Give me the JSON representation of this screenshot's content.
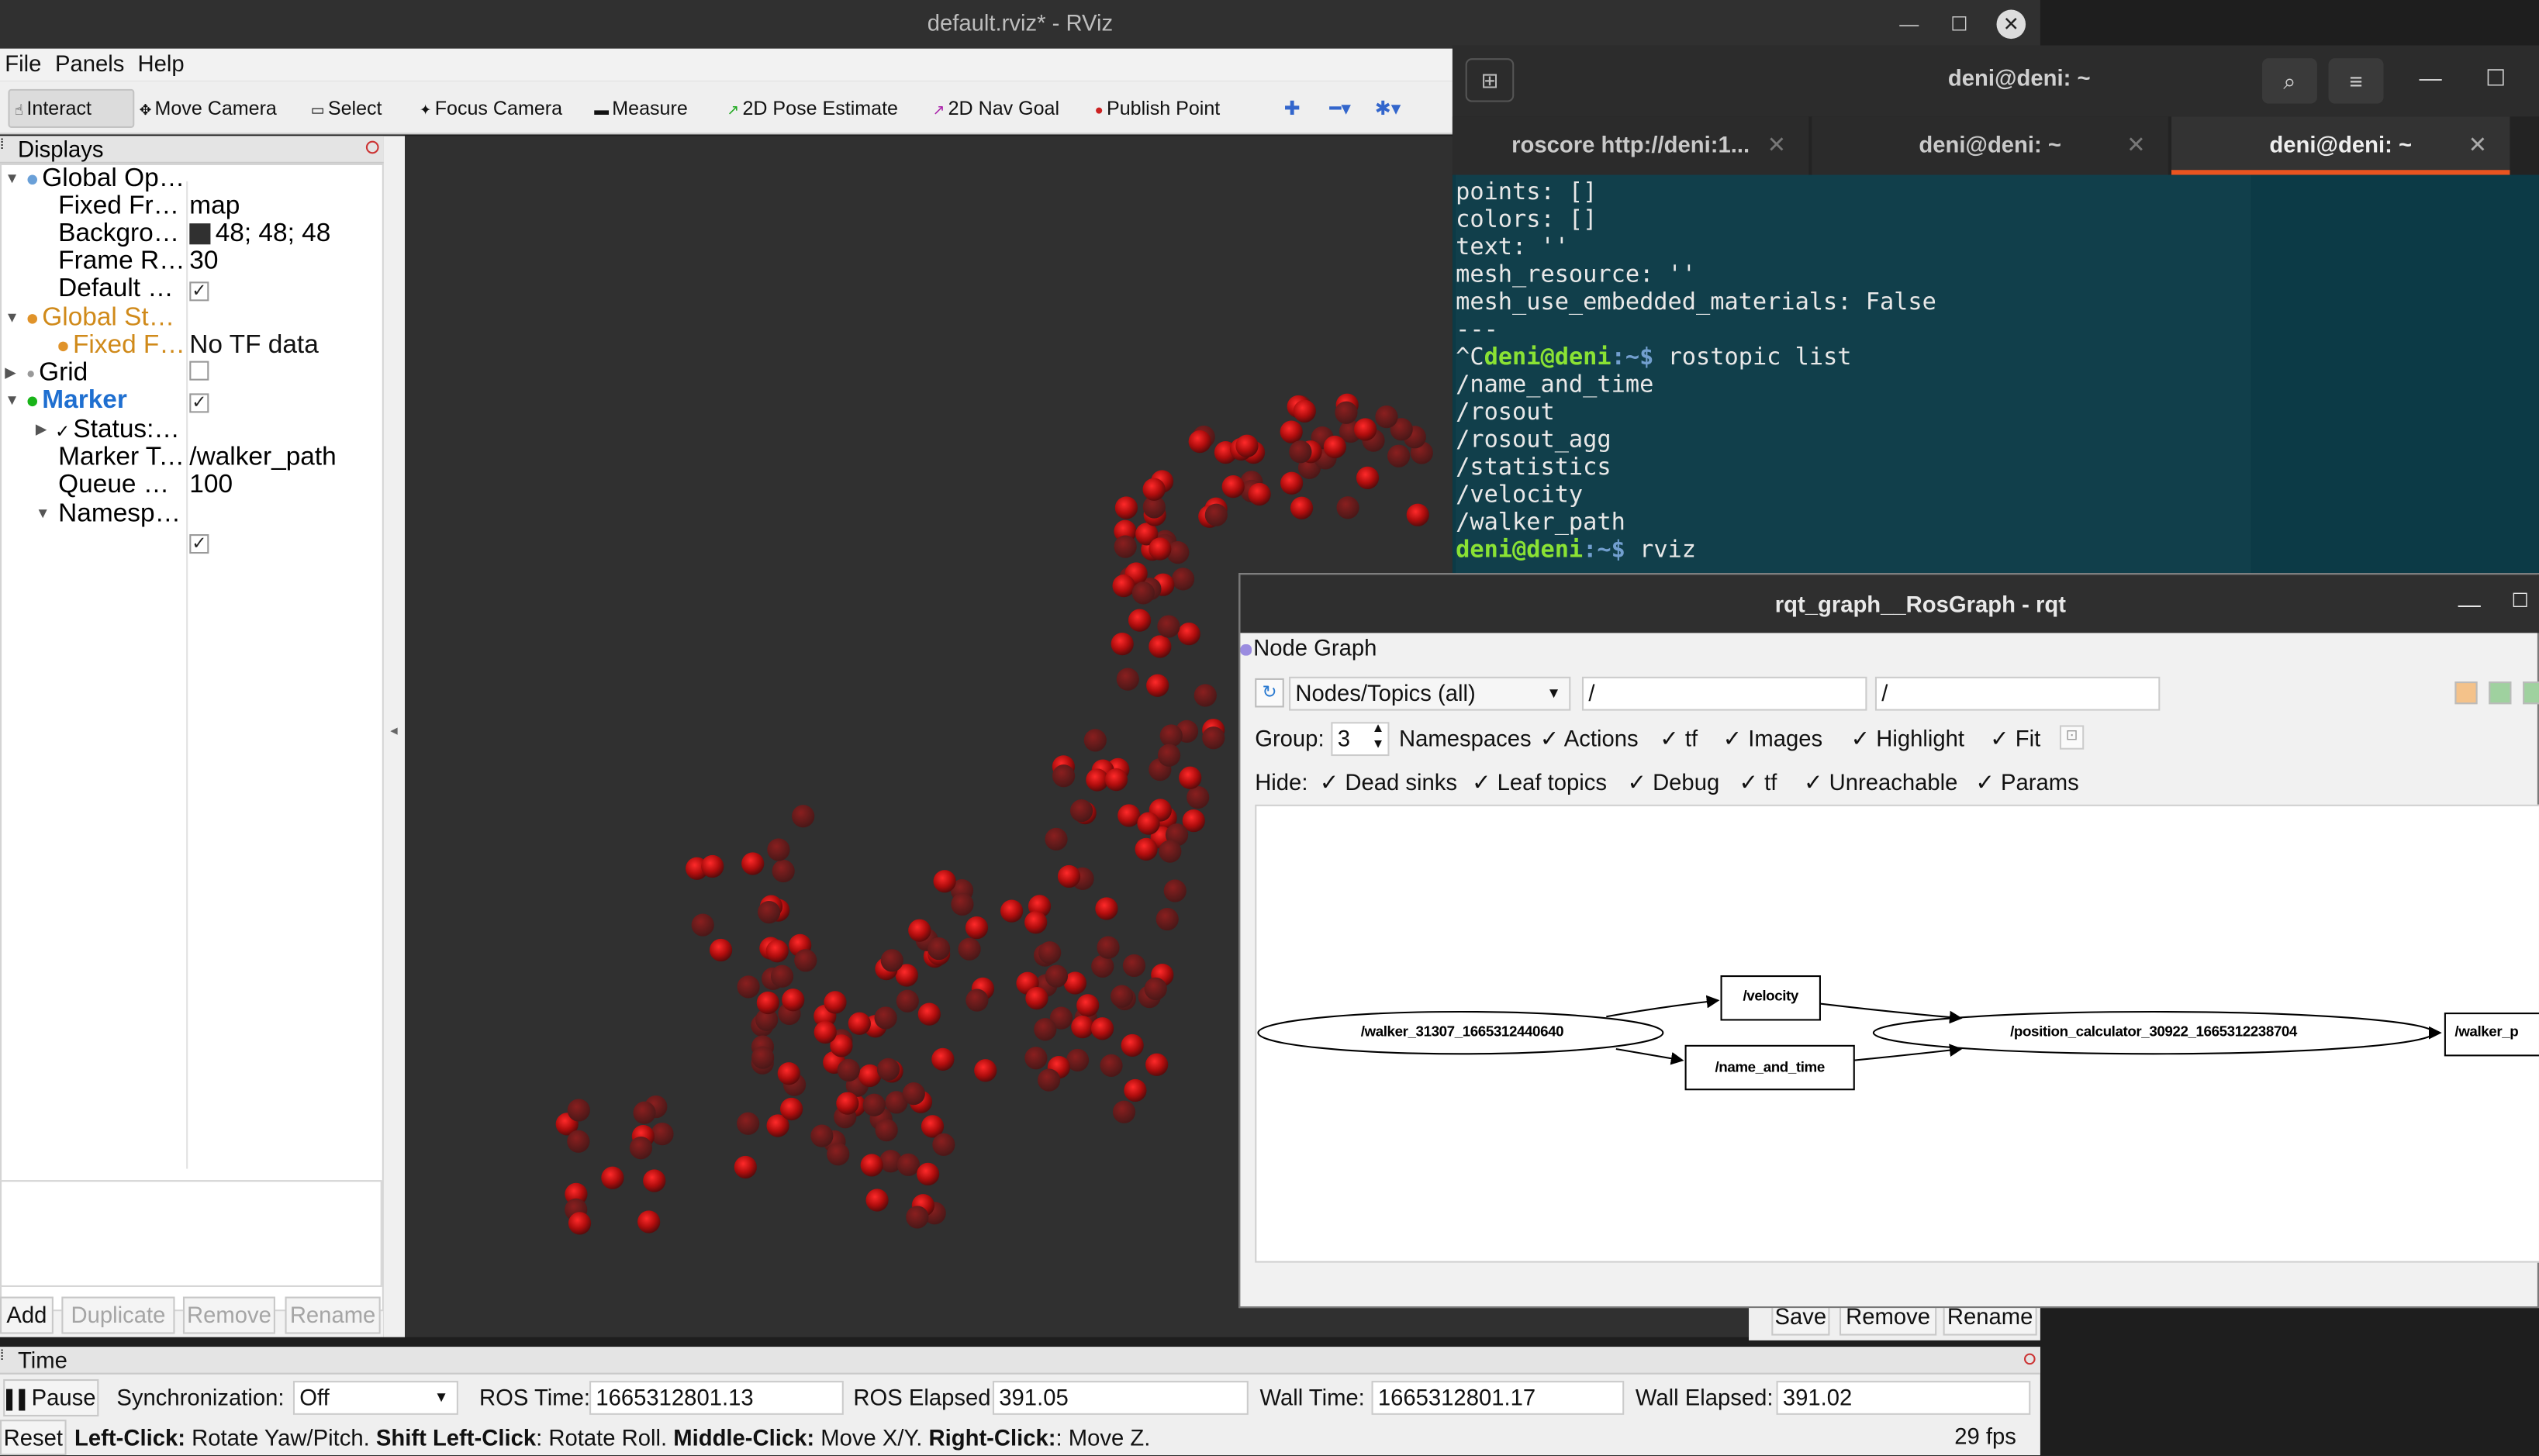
{
  "rviz": {
    "title": "default.rviz* - RViz",
    "menu": [
      "File",
      "Panels",
      "Help"
    ],
    "toolbar": [
      "Interact",
      "Move Camera",
      "Select",
      "Focus Camera",
      "Measure",
      "2D Pose Estimate",
      "2D Nav Goal",
      "Publish Point"
    ],
    "displays": {
      "title": "Displays",
      "rows": [
        {
          "key": "Global Opti...",
          "value": ""
        },
        {
          "key": "Fixed Frame",
          "value": "map"
        },
        {
          "key": "Backgrou...",
          "value": "48; 48; 48"
        },
        {
          "key": "Frame Rate",
          "value": "30"
        },
        {
          "key": "Default Li...",
          "value": "✓"
        },
        {
          "key": "Global Stat...",
          "value": ""
        },
        {
          "key": "Fixed Fr...",
          "value": "No TF data"
        },
        {
          "key": "Grid",
          "value": ""
        },
        {
          "key": "Marker",
          "value": "✓"
        },
        {
          "key": "Status: Ok",
          "value": ""
        },
        {
          "key": "Marker To...",
          "value": "/walker_path"
        },
        {
          "key": "Queue Size",
          "value": "100"
        },
        {
          "key": "Namespa...",
          "value": ""
        },
        {
          "key": "",
          "value": "✓"
        }
      ],
      "buttons": [
        "Add",
        "Duplicate",
        "Remove",
        "Rename"
      ]
    },
    "time": {
      "title": "Time",
      "pause": "Pause",
      "sync_label": "Synchronization:",
      "sync_value": "Off",
      "ros_time_label": "ROS Time:",
      "ros_time": "1665312801.13",
      "ros_elapsed_label": "ROS Elapsed:",
      "ros_elapsed": "391.05",
      "wall_time_label": "Wall Time:",
      "wall_time": "1665312801.17",
      "wall_elapsed_label": "Wall Elapsed:",
      "wall_elapsed": "391.02",
      "reset": "Reset",
      "fps": "29 fps"
    },
    "help": [
      {
        "b": "Left-Click:",
        "t": " Rotate Yaw/Pitch. "
      },
      {
        "b": "Shift Left-Click",
        "t": ": Rotate Roll. "
      },
      {
        "b": "Middle-Click:",
        "t": " Move X/Y. "
      },
      {
        "b": "Right-Click:",
        "t": ": Move Z."
      }
    ],
    "under_buttons": [
      "Save",
      "Remove",
      "Rename"
    ]
  },
  "terminal": {
    "title": "deni@deni: ~",
    "tabs": [
      "roscore http://deni:1...",
      "deni@deni: ~",
      "deni@deni: ~"
    ],
    "lines": [
      "points: []",
      "colors: []",
      "text: ''",
      "mesh_resource: ''",
      "mesh_use_embedded_materials: False",
      "---"
    ],
    "prompt_prefix": "^C",
    "prompt_user": "deni@deni",
    "prompt_path": ":~$ ",
    "cmd1": "rostopic list",
    "topics": [
      "/name_and_time",
      "/rosout",
      "/rosout_agg",
      "/statistics",
      "/velocity",
      "/walker_path"
    ],
    "cmd2": "rviz"
  },
  "rqt": {
    "title": "rqt_graph__RosGraph - rqt",
    "plugin": "Node Graph",
    "mode": "Nodes/Topics (all)",
    "filter1": "/",
    "filter2": "/",
    "group_label": "Group:",
    "group_value": "3",
    "group_opts": [
      "Namespaces",
      "Actions",
      "tf",
      "Images",
      "Highlight",
      "Fit"
    ],
    "hide_label": "Hide:",
    "hide_opts": [
      "Dead sinks",
      "Leaf topics",
      "Debug",
      "tf",
      "Unreachable",
      "Params"
    ],
    "nodes": [
      "/walker_31307_1665312440640",
      "/velocity",
      "/name_and_time",
      "/position_calculator_30922_1665312238704",
      "/walker_p"
    ]
  },
  "colors": {
    "marker": "#d41414",
    "terminal_bg": "#0c3a46",
    "prompt": "#8ae234",
    "accent_tab": "#e95420"
  }
}
